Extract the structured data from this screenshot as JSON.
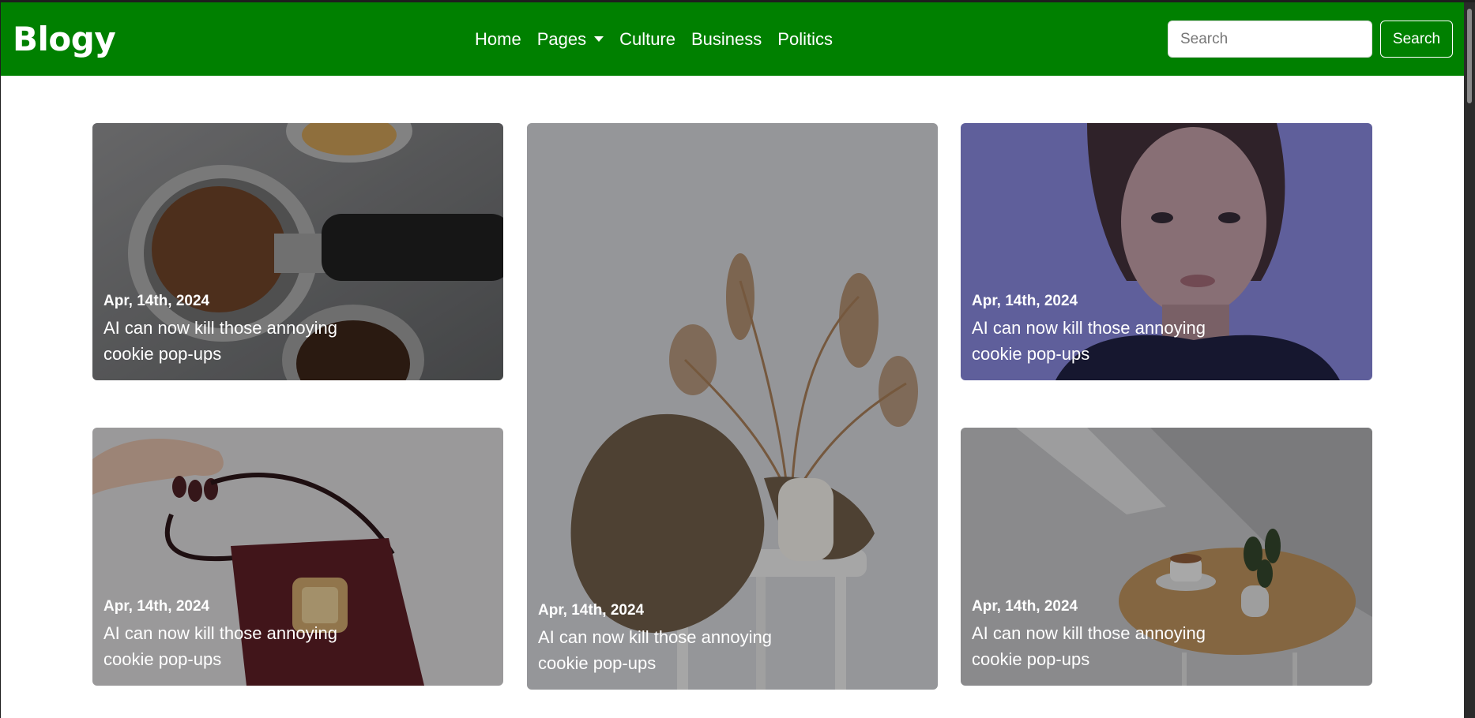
{
  "brand": "Blogy",
  "nav": {
    "items": [
      {
        "label": "Home"
      },
      {
        "label": "Pages"
      },
      {
        "label": "Culture"
      },
      {
        "label": "Business"
      },
      {
        "label": "Politics"
      }
    ]
  },
  "search": {
    "placeholder": "Search",
    "button_label": "Search"
  },
  "cards": [
    {
      "date": "Apr, 14th, 2024",
      "title": "AI can now kill those annoying cookie pop-ups",
      "image": "coffee-portafilter"
    },
    {
      "date": "Apr, 14th, 2024",
      "title": "AI can now kill those annoying cookie pop-ups",
      "image": "knit-sweater-vase"
    },
    {
      "date": "Apr, 14th, 2024",
      "title": "AI can now kill those annoying cookie pop-ups",
      "image": "woman-portrait"
    },
    {
      "date": "Apr, 14th, 2024",
      "title": "AI can now kill those annoying cookie pop-ups",
      "image": "handbag"
    },
    {
      "date": "Apr, 14th, 2024",
      "title": "AI can now kill those annoying cookie pop-ups",
      "image": "coffee-table"
    }
  ],
  "colors": {
    "navbar": "#008000",
    "text": "#ffffff"
  }
}
